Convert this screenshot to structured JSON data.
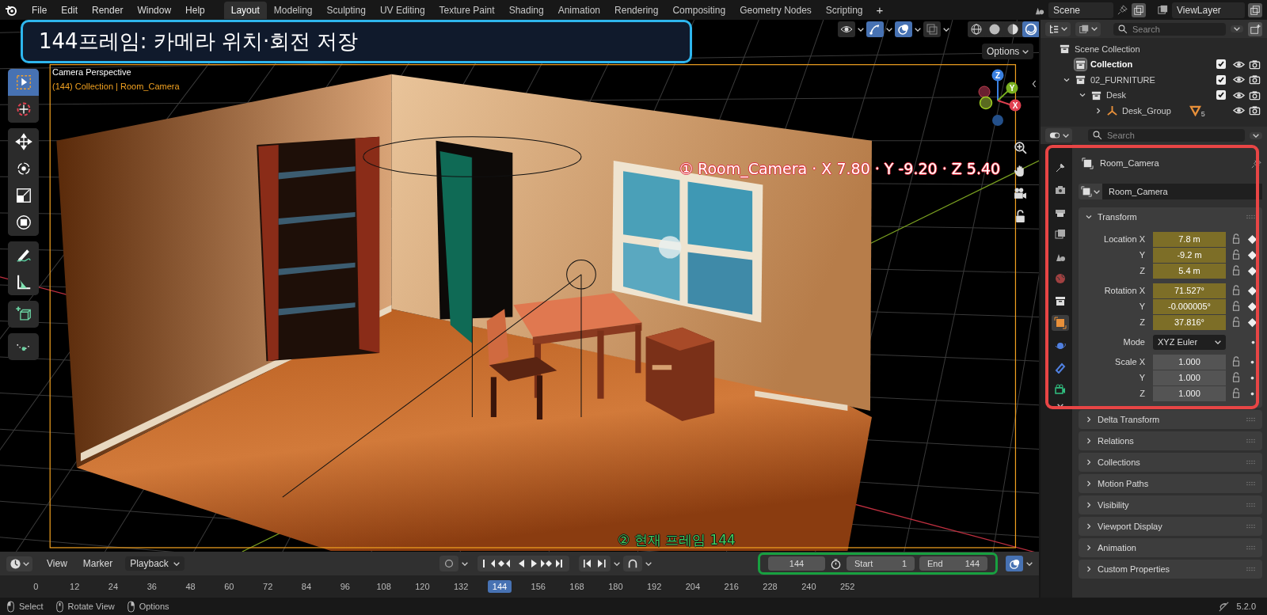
{
  "menu": [
    "File",
    "Edit",
    "Render",
    "Window",
    "Help"
  ],
  "workspaces": [
    {
      "label": "Layout",
      "selected": true
    },
    {
      "label": "Modeling",
      "selected": false
    },
    {
      "label": "Sculpting",
      "selected": false
    },
    {
      "label": "UV Editing",
      "selected": false
    },
    {
      "label": "Texture Paint",
      "selected": false
    },
    {
      "label": "Shading",
      "selected": false
    },
    {
      "label": "Animation",
      "selected": false
    },
    {
      "label": "Rendering",
      "selected": false
    },
    {
      "label": "Compositing",
      "selected": false
    },
    {
      "label": "Geometry Nodes",
      "selected": false
    },
    {
      "label": "Scripting",
      "selected": false
    }
  ],
  "add_workspace": "+",
  "scene_field": "Scene",
  "view_layer_field": "ViewLayer",
  "callout": {
    "title": "144프레임: 카메라 위치·회전 저장"
  },
  "viewport": {
    "view_name": "Camera Perspective",
    "object_info": "(144) Collection | Room_Camera",
    "options_button": "Options",
    "header_toggles": [
      {
        "kind": "visibility",
        "selected": false
      },
      {
        "kind": "gizmo",
        "selected": true
      },
      {
        "kind": "overlay",
        "selected": true
      },
      {
        "kind": "xray",
        "selected": false
      }
    ],
    "shading_modes": [
      {
        "kind": "wireframe",
        "selected": false
      },
      {
        "kind": "solid",
        "selected": false
      },
      {
        "kind": "material",
        "selected": false
      },
      {
        "kind": "rendered",
        "selected": true
      }
    ],
    "tool_groups": [
      [
        {
          "kind": "select",
          "selected": true
        },
        {
          "kind": "cursor",
          "selected": false
        }
      ],
      [
        {
          "kind": "move",
          "selected": false
        },
        {
          "kind": "rotate",
          "selected": false
        },
        {
          "kind": "scale",
          "selected": false
        },
        {
          "kind": "transform",
          "selected": false
        }
      ],
      [
        {
          "kind": "annotate",
          "selected": false
        },
        {
          "kind": "measure",
          "selected": false
        }
      ],
      [
        {
          "kind": "add",
          "selected": false
        }
      ],
      [
        {
          "kind": "curve",
          "selected": false
        }
      ]
    ],
    "axes": [
      {
        "label": "Z"
      },
      {
        "label": "Y"
      },
      {
        "label": "X"
      }
    ]
  },
  "annotations": [
    {
      "kind": "object",
      "text": "① Room_Camera · X 7.80 · Y -9.20 · Z 5.40"
    },
    {
      "kind": "frame",
      "text": "② 현재 프레임 144"
    }
  ],
  "outliner": {
    "search": {
      "placeholder": "Search"
    },
    "tree": [
      {
        "label": "Scene Collection",
        "kind": "scene",
        "selected": false,
        "children": [
          {
            "label": "Collection",
            "kind": "collection",
            "selected": true,
            "checked": true
          },
          {
            "label": "02_FURNITURE",
            "kind": "collection",
            "selected": false,
            "checked": true,
            "expanded": true,
            "children": [
              {
                "label": "Desk",
                "kind": "collection",
                "selected": false,
                "checked": true,
                "expanded": true,
                "children": [
                  {
                    "label": "Desk_Group",
                    "kind": "empty",
                    "selected": false,
                    "expanded": false,
                    "badge": "5"
                  }
                ]
              }
            ]
          }
        ]
      }
    ]
  },
  "properties": {
    "search": {
      "placeholder": "Search"
    },
    "tabs": [
      {
        "kind": "tool",
        "selected": false
      },
      {
        "kind": "render",
        "selected": false
      },
      {
        "kind": "output",
        "selected": false
      },
      {
        "kind": "view_layer",
        "selected": false
      },
      {
        "kind": "scene",
        "selected": false
      },
      {
        "kind": "world",
        "selected": false
      },
      {
        "kind": "collection",
        "selected": false
      },
      {
        "kind": "object",
        "selected": true
      },
      {
        "kind": "physics",
        "selected": false
      },
      {
        "kind": "constraints",
        "selected": false
      },
      {
        "kind": "data",
        "selected": false
      }
    ],
    "object_name": "Room_Camera",
    "data_name": "Room_Camera",
    "transform": {
      "title": "Transform",
      "expanded": true,
      "groups": [
        {
          "kind": "fields",
          "rows": [
            {
              "label": "Location X",
              "value": "7.8 m",
              "keyed": true
            },
            {
              "label": "Y",
              "value": "-9.2 m",
              "keyed": true
            },
            {
              "label": "Z",
              "value": "5.4 m",
              "keyed": true
            }
          ]
        },
        {
          "kind": "fields",
          "rows": [
            {
              "label": "Rotation X",
              "value": "71.527°",
              "keyed": true
            },
            {
              "label": "Y",
              "value": "-0.000005°",
              "keyed": true
            },
            {
              "label": "Z",
              "value": "37.816°",
              "keyed": true
            }
          ]
        },
        {
          "kind": "dropdown",
          "label": "Mode",
          "value": "XYZ Euler"
        },
        {
          "kind": "fields",
          "rows": [
            {
              "label": "Scale X",
              "value": "1.000",
              "keyed": false
            },
            {
              "label": "Y",
              "value": "1.000",
              "keyed": false
            },
            {
              "label": "Z",
              "value": "1.000",
              "keyed": false
            }
          ]
        }
      ]
    },
    "panels": [
      {
        "title": "Delta Transform",
        "expanded": false
      },
      {
        "title": "Relations",
        "expanded": false
      },
      {
        "title": "Collections",
        "expanded": false
      },
      {
        "title": "Motion Paths",
        "expanded": false
      },
      {
        "title": "Visibility",
        "expanded": false
      },
      {
        "title": "Viewport Display",
        "expanded": false
      },
      {
        "title": "Animation",
        "expanded": false
      },
      {
        "title": "Custom Properties",
        "expanded": false
      }
    ]
  },
  "timeline": {
    "menus": [
      "View",
      "Marker"
    ],
    "playback": "Playback",
    "current_frame": "144",
    "start_label": "Start",
    "start": "1",
    "end_label": "End",
    "end": "144",
    "ticks": [
      {
        "label": "0",
        "selected": false
      },
      {
        "label": "12",
        "selected": false
      },
      {
        "label": "24",
        "selected": false
      },
      {
        "label": "36",
        "selected": false
      },
      {
        "label": "48",
        "selected": false
      },
      {
        "label": "60",
        "selected": false
      },
      {
        "label": "72",
        "selected": false
      },
      {
        "label": "84",
        "selected": false
      },
      {
        "label": "96",
        "selected": false
      },
      {
        "label": "108",
        "selected": false
      },
      {
        "label": "120",
        "selected": false
      },
      {
        "label": "132",
        "selected": false
      },
      {
        "label": "144",
        "selected": true
      },
      {
        "label": "156",
        "selected": false
      },
      {
        "label": "168",
        "selected": false
      },
      {
        "label": "180",
        "selected": false
      },
      {
        "label": "192",
        "selected": false
      },
      {
        "label": "204",
        "selected": false
      },
      {
        "label": "216",
        "selected": false
      },
      {
        "label": "228",
        "selected": false
      },
      {
        "label": "240",
        "selected": false
      },
      {
        "label": "252",
        "selected": false
      }
    ]
  },
  "status_bar": {
    "hints": [
      {
        "kind": "left",
        "label": "Select"
      },
      {
        "kind": "middle",
        "label": "Rotate View"
      },
      {
        "kind": "right",
        "label": "Options"
      }
    ],
    "version": "5.2.0"
  }
}
